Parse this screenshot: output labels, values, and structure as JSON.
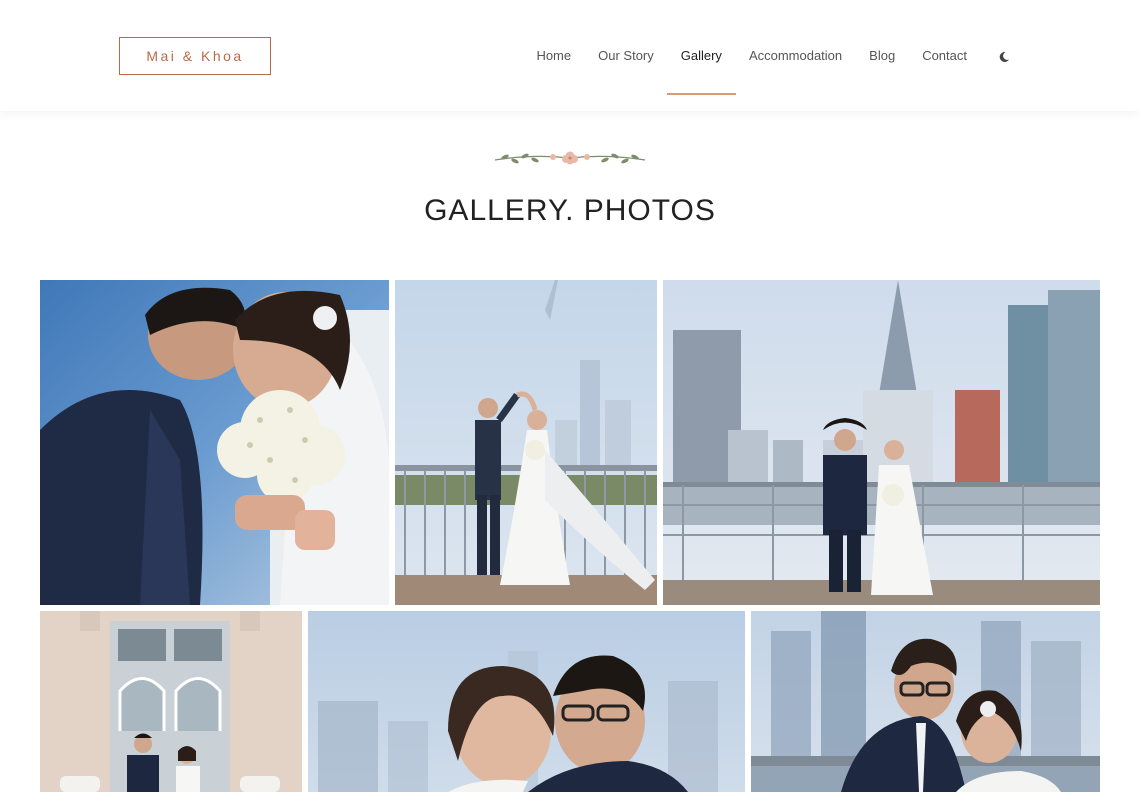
{
  "header": {
    "logo": "Mai & Khoa",
    "nav": [
      {
        "label": "Home",
        "active": false
      },
      {
        "label": "Our Story",
        "active": false
      },
      {
        "label": "Gallery",
        "active": true
      },
      {
        "label": "Accommodation",
        "active": false
      },
      {
        "label": "Blog",
        "active": false
      },
      {
        "label": "Contact",
        "active": false
      }
    ],
    "theme_toggle_icon": "moon-icon"
  },
  "section": {
    "ornament_icon": "floral-divider-icon",
    "title": "GALLERY. PHOTOS"
  },
  "colors": {
    "accent": "#b96a48",
    "active_underline": "#d99a7a",
    "text_dark": "#222222",
    "nav_text": "#555555"
  },
  "gallery": {
    "photos": [
      {
        "name": "photo-couple-kiss-bouquet"
      },
      {
        "name": "photo-couple-dancing-bridge"
      },
      {
        "name": "photo-couple-city-skyline"
      },
      {
        "name": "photo-couple-doorway"
      },
      {
        "name": "photo-couple-portrait-closeup"
      },
      {
        "name": "photo-couple-skyline-closeup"
      }
    ]
  }
}
